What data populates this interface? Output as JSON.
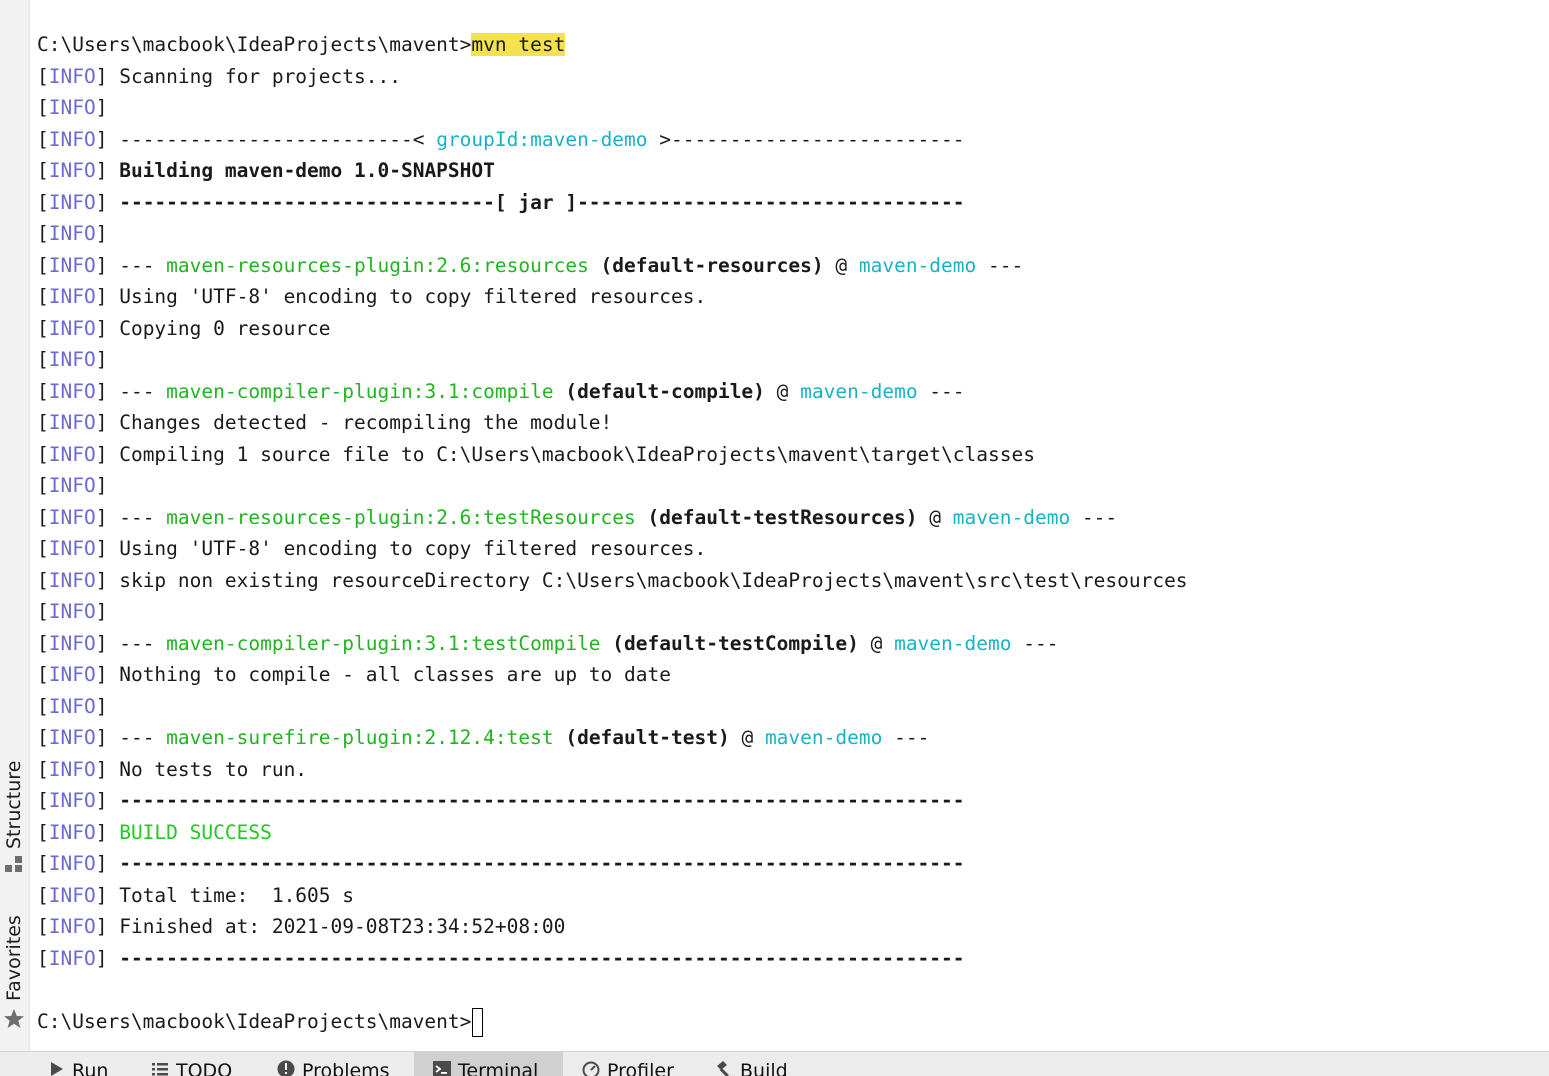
{
  "left_toolbar": {
    "structure_label": "Structure",
    "favorites_label": "Favorites"
  },
  "terminal": {
    "prompt": "C:\\Users\\macbook\\IdeaProjects\\mavent>",
    "command": "mvn test",
    "info_tag": "INFO",
    "lines": {
      "scanning": " Scanning for projects...",
      "group_pre": " -------------------------< ",
      "group_id": "groupId:maven-demo",
      "group_post": " >-------------------------",
      "building": "Building maven-demo 1.0-SNAPSHOT",
      "jar_line": " --------------------------------[ jar ]---------------------------------",
      "res_plugin": "maven-resources-plugin:2.6:resources",
      "res_goal": " (default-resources)",
      "encoding_1": " Using 'UTF-8' encoding to copy filtered resources.",
      "copying": " Copying 0 resource",
      "comp_plugin": "maven-compiler-plugin:3.1:compile",
      "comp_goal": " (default-compile)",
      "changes": " Changes detected - recompiling the module!",
      "compiling": " Compiling 1 source file to C:\\Users\\macbook\\IdeaProjects\\mavent\\target\\classes",
      "testres_plugin": "maven-resources-plugin:2.6:testResources",
      "testres_goal": " (default-testResources)",
      "encoding_2": " Using 'UTF-8' encoding to copy filtered resources.",
      "skip": " skip non existing resourceDirectory C:\\Users\\macbook\\IdeaProjects\\mavent\\src\\test\\resources",
      "testcomp_plugin": "maven-compiler-plugin:3.1:testCompile",
      "testcomp_goal": " (default-testCompile)",
      "nothing": " Nothing to compile - all classes are up to date",
      "surefire_plugin": "maven-surefire-plugin:2.12.4:test",
      "surefire_goal": " (default-test)",
      "no_tests": " No tests to run.",
      "separator": " ------------------------------------------------------------------------",
      "build_success": "BUILD SUCCESS",
      "total_time": " Total time:  1.605 s",
      "finished_at": " Finished at: 2021-09-08T23:34:52+08:00",
      "module": "maven-demo",
      "dashes_pre": " --- ",
      "at_sign": " @ ",
      "dashes_post": " ---"
    }
  },
  "bottom_toolbar": {
    "tabs": [
      {
        "label": "Run",
        "icon": "run-icon"
      },
      {
        "label": "TODO",
        "icon": "todo-icon"
      },
      {
        "label": "Problems",
        "icon": "problems-icon"
      },
      {
        "label": "Terminal",
        "icon": "terminal-icon",
        "active": true
      },
      {
        "label": "Profiler",
        "icon": "profiler-icon"
      },
      {
        "label": "Build",
        "icon": "build-icon"
      }
    ]
  },
  "colors": {
    "info": "#6a6ad0",
    "plugin": "#22b422",
    "module": "#19b3c4",
    "success": "#22c922",
    "command_highlight": "#f5e050"
  }
}
